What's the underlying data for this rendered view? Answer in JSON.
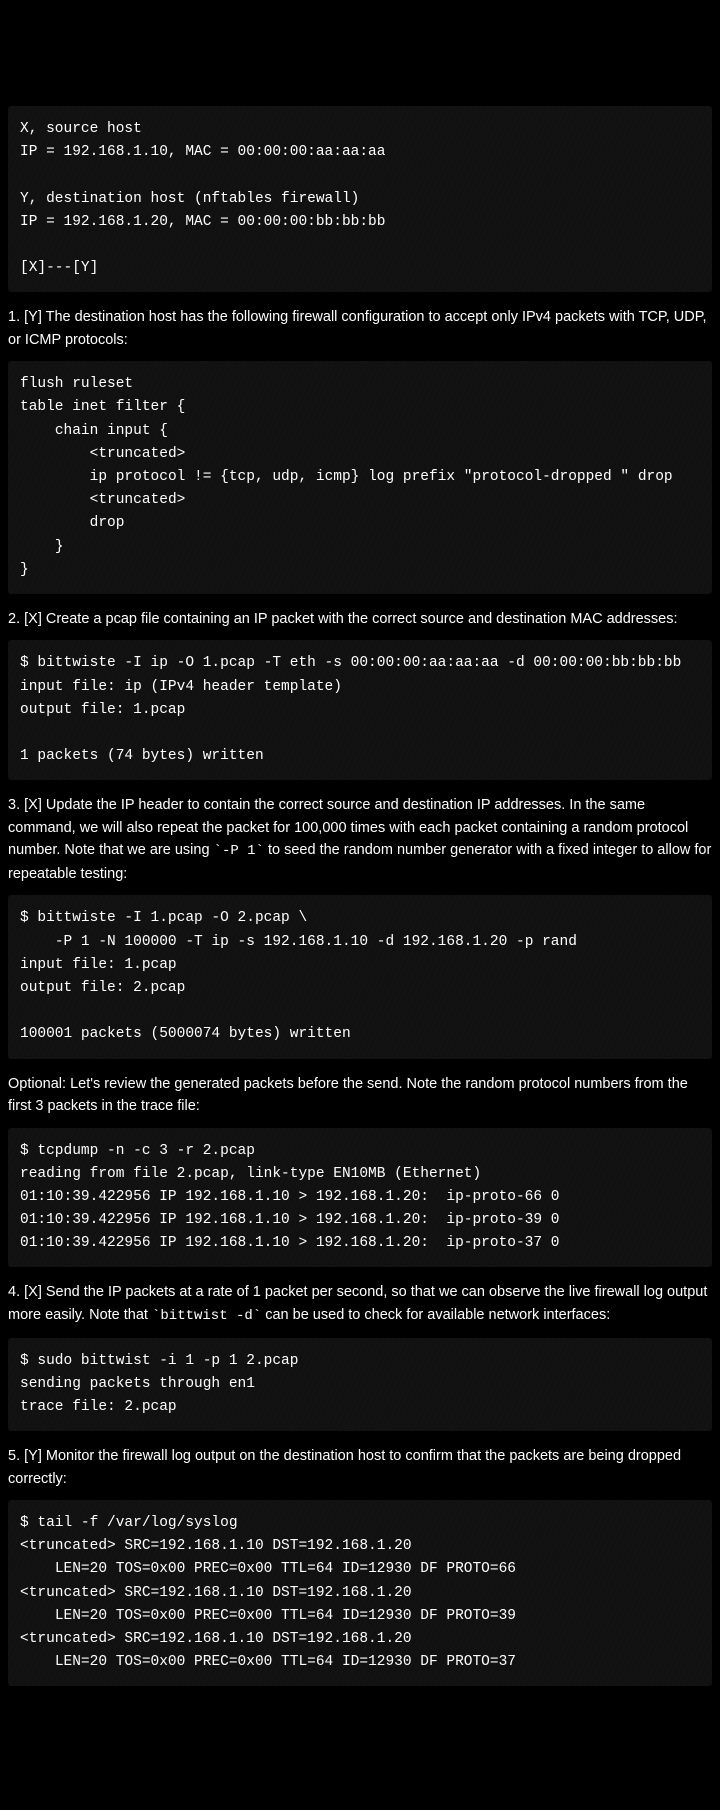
{
  "blocks": {
    "pre1": "X, source host\nIP = 192.168.1.10, MAC = 00:00:00:aa:aa:aa\n\nY, destination host (nftables firewall)\nIP = 192.168.1.20, MAC = 00:00:00:bb:bb:bb\n\n[X]---[Y]",
    "p1": "1. [Y] The destination host has the following firewall configuration to accept only IPv4 packets with TCP, UDP, or ICMP protocols:",
    "pre2": "flush ruleset\ntable inet filter {\n    chain input {\n        <truncated>\n        ip protocol != {tcp, udp, icmp} log prefix \"protocol-dropped \" drop\n        <truncated>\n        drop\n    }\n}",
    "p2": "2. [X] Create a pcap file containing an IP packet with the correct source and destination MAC addresses:",
    "pre3": "$ bittwiste -I ip -O 1.pcap -T eth -s 00:00:00:aa:aa:aa -d 00:00:00:bb:bb:bb\ninput file: ip (IPv4 header template)\noutput file: 1.pcap\n\n1 packets (74 bytes) written",
    "p3_a": "3. [X] Update the IP header to contain the correct source and destination IP addresses. In the same command, we will also repeat the packet for 100,000 times with each packet containing a random protocol number. Note that we are using ",
    "p3_code": "`-P 1`",
    "p3_b": " to seed the random number generator with a fixed integer to allow for repeatable testing:",
    "pre4": "$ bittwiste -I 1.pcap -O 2.pcap \\\n    -P 1 -N 100000 -T ip -s 192.168.1.10 -d 192.168.1.20 -p rand\ninput file: 1.pcap\noutput file: 2.pcap\n\n100001 packets (5000074 bytes) written",
    "p4": "Optional: Let's review the generated packets before the send. Note the random protocol numbers from the first 3 packets in the trace file:",
    "pre5": "$ tcpdump -n -c 3 -r 2.pcap\nreading from file 2.pcap, link-type EN10MB (Ethernet)\n01:10:39.422956 IP 192.168.1.10 > 192.168.1.20:  ip-proto-66 0\n01:10:39.422956 IP 192.168.1.10 > 192.168.1.20:  ip-proto-39 0\n01:10:39.422956 IP 192.168.1.10 > 192.168.1.20:  ip-proto-37 0",
    "p5_a": "4. [X] Send the IP packets at a rate of 1 packet per second, so that we can observe the live firewall log output more easily. Note that ",
    "p5_code": "`bittwist -d`",
    "p5_b": " can be used to check for available network interfaces:",
    "pre6": "$ sudo bittwist -i 1 -p 1 2.pcap\nsending packets through en1\ntrace file: 2.pcap",
    "p6": "5. [Y] Monitor the firewall log output on the destination host to confirm that the packets are being dropped correctly:",
    "pre7": "$ tail -f /var/log/syslog\n<truncated> SRC=192.168.1.10 DST=192.168.1.20\n    LEN=20 TOS=0x00 PREC=0x00 TTL=64 ID=12930 DF PROTO=66\n<truncated> SRC=192.168.1.10 DST=192.168.1.20\n    LEN=20 TOS=0x00 PREC=0x00 TTL=64 ID=12930 DF PROTO=39\n<truncated> SRC=192.168.1.10 DST=192.168.1.20\n    LEN=20 TOS=0x00 PREC=0x00 TTL=64 ID=12930 DF PROTO=37"
  }
}
